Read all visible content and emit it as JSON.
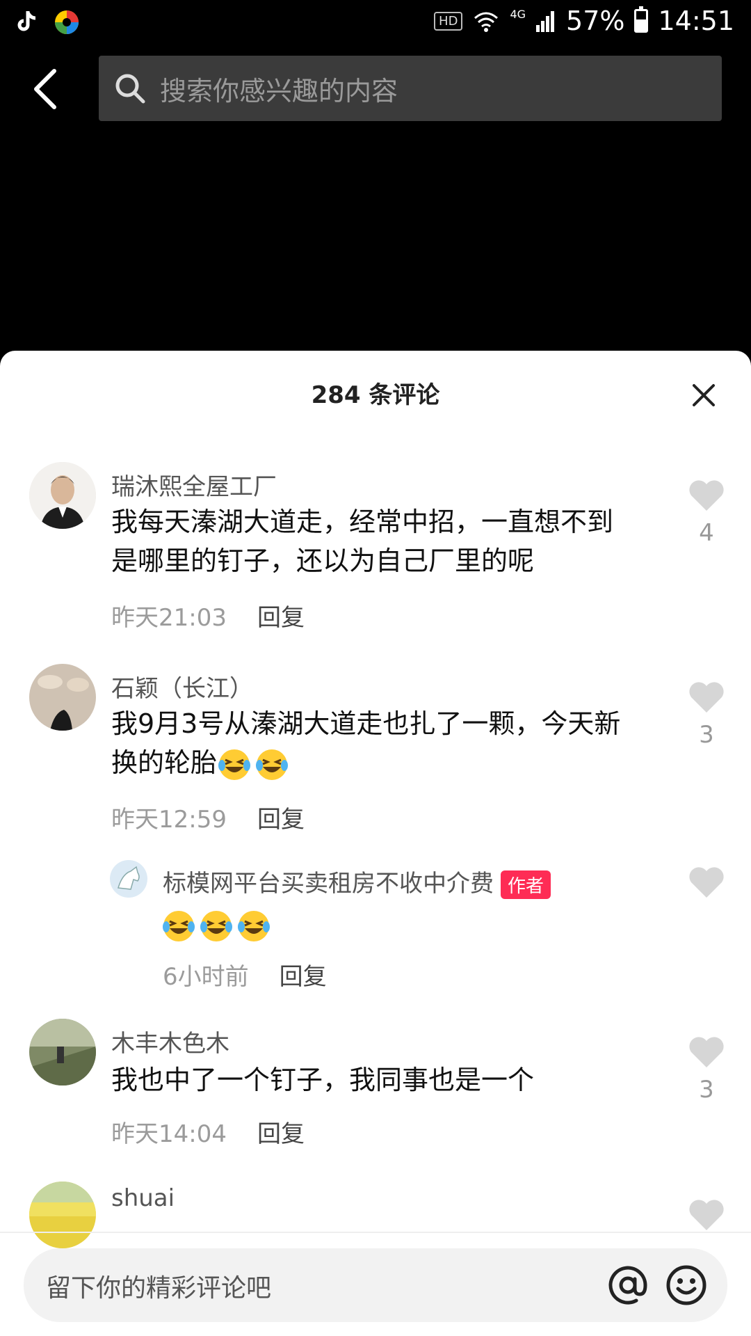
{
  "status_bar": {
    "hd": "HD",
    "network": "4G",
    "battery": "57%",
    "battery_level": 0.57,
    "time": "14:51"
  },
  "search": {
    "placeholder": "搜索你感兴趣的内容"
  },
  "comments_panel": {
    "title": "284 条评论"
  },
  "comments": [
    {
      "username": "瑞沐熙全屋工厂",
      "text_lines": [
        "我每天溱湖大道走，经常中招，一直想不到",
        "是哪里的钉子，还以为自己厂里的呢"
      ],
      "time": "昨天21:03",
      "reply": "回复",
      "likes": "4"
    },
    {
      "username": "石颖（长江）",
      "text_lines": [
        "我9月3号从溱湖大道走也扎了一颗，今天新",
        "换的轮胎"
      ],
      "emoji_count": 2,
      "time": "昨天12:59",
      "reply": "回复",
      "likes": "3"
    },
    {
      "username": "标模网平台买卖租房不收中介费",
      "author_tag": "作者",
      "emoji_count": 3,
      "time": "6小时前",
      "reply": "回复",
      "likes": ""
    },
    {
      "username": "木丰木色木",
      "text_lines": [
        "我也中了一个钉子，我同事也是一个"
      ],
      "time": "昨天14:04",
      "reply": "回复",
      "likes": "3"
    },
    {
      "username": "shuai",
      "likes": ""
    }
  ],
  "input": {
    "placeholder": "留下你的精彩评论吧"
  },
  "colors": {
    "author_tag": "#fe2c55",
    "sheet_bg": "#ffffff",
    "search_bg": "#3b3b3b"
  }
}
